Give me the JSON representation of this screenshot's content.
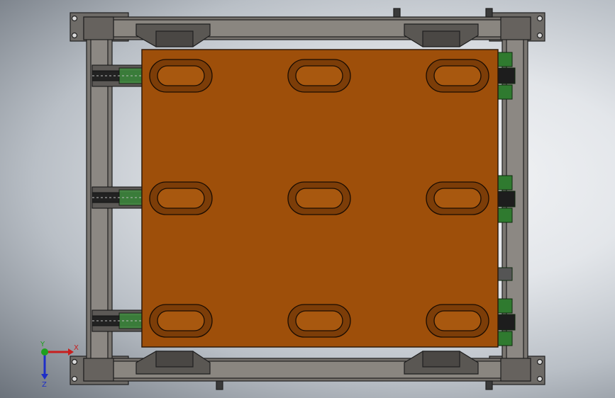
{
  "viewport": {
    "background_center": "#f4f5f7",
    "background_edge": "#6b727b"
  },
  "model": {
    "plate_color": "#9e4f0a",
    "frame_color": "#6e6b67",
    "frame_edge": "#1f1f1f",
    "roller_color": "#2f7a2f",
    "slot_rows": 3,
    "slot_cols": 3
  },
  "triad": {
    "x_label": "X",
    "y_label": "Y",
    "z_label": "Z",
    "x_color": "#c81e1e",
    "y_color": "#1ea01e",
    "z_color": "#1e2ec8"
  }
}
